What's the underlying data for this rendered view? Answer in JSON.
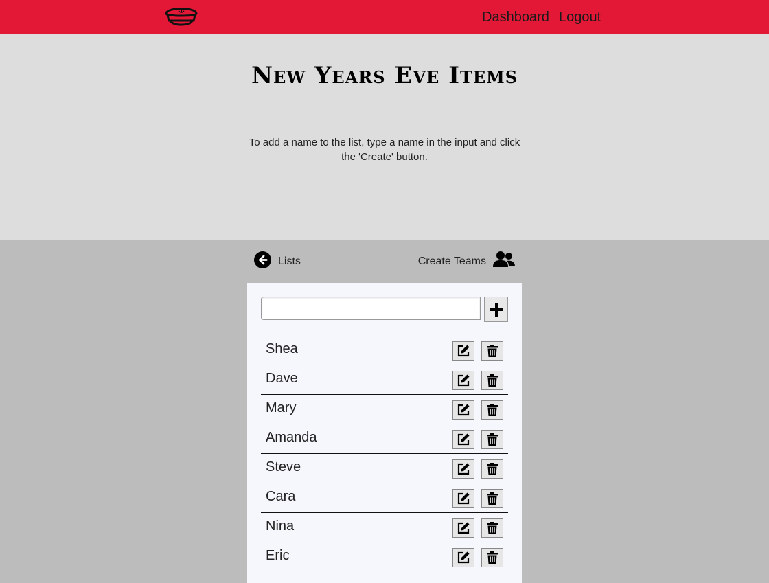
{
  "nav": {
    "logo_icon": "captain-hat-icon",
    "dashboard_label": "Dashboard",
    "logout_label": "Logout",
    "brand_color": "#e31837"
  },
  "hero": {
    "title": "New Years Eve Items",
    "description": "To add a name to the list, type a name in the input and click the 'Create' button."
  },
  "subnav": {
    "back_icon": "arrow-circle-left-icon",
    "back_label": "Lists",
    "teams_label": "Create Teams",
    "teams_icon": "users-icon"
  },
  "form": {
    "input_value": "",
    "input_placeholder": "",
    "add_icon": "plus-icon"
  },
  "items": [
    {
      "name": "Shea"
    },
    {
      "name": "Dave"
    },
    {
      "name": "Mary"
    },
    {
      "name": "Amanda"
    },
    {
      "name": "Steve"
    },
    {
      "name": "Cara"
    },
    {
      "name": "Nina"
    },
    {
      "name": "Eric"
    }
  ],
  "row_actions": {
    "edit_icon": "edit-icon",
    "delete_icon": "trash-icon"
  }
}
